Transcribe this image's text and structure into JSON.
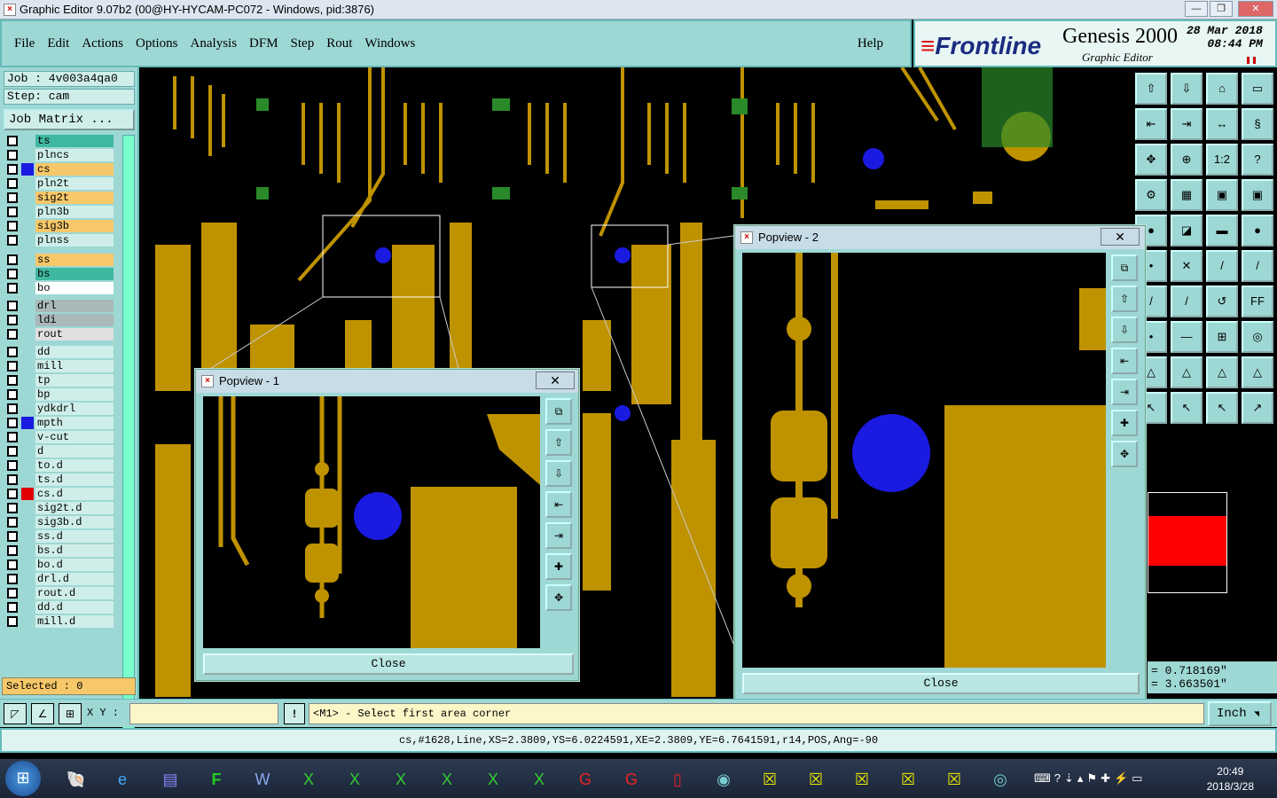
{
  "window": {
    "title": "Graphic Editor 9.07b2 (00@HY-HYCAM-PC072 - Windows, pid:3876)",
    "min": "—",
    "max": "❐",
    "close": "✕"
  },
  "menu": [
    "File",
    "Edit",
    "Actions",
    "Options",
    "Analysis",
    "DFM",
    "Step",
    "Rout",
    "Windows"
  ],
  "help": "Help",
  "brand": {
    "logo_prefix": "≡",
    "logo": "Frontline",
    "product": "Genesis 2000",
    "subtitle": "Graphic Editor",
    "date": "28 Mar 2018",
    "time": "08:44 PM"
  },
  "job": "Job : 4v003a4qa0",
  "step": "Step: cam",
  "job_matrix": "Job Matrix ...",
  "layers": [
    {
      "name": "ts",
      "bg": "#3fb8a0",
      "color": ""
    },
    {
      "name": "plncs",
      "bg": "#cfeee9",
      "color": ""
    },
    {
      "name": "cs",
      "bg": "#f7c86a",
      "color": "#1a1ae0"
    },
    {
      "name": "pln2t",
      "bg": "#cfeee9",
      "color": ""
    },
    {
      "name": "sig2t",
      "bg": "#f7c86a",
      "color": ""
    },
    {
      "name": "pln3b",
      "bg": "#cfeee9",
      "color": ""
    },
    {
      "name": "sig3b",
      "bg": "#f7c86a",
      "color": ""
    },
    {
      "name": "plnss",
      "bg": "#cfeee9",
      "color": ""
    },
    {
      "name": "ss",
      "bg": "#f7c86a",
      "color": ""
    },
    {
      "name": "bs",
      "bg": "#3fb8a0",
      "color": ""
    },
    {
      "name": "bo",
      "bg": "#ffffff",
      "color": ""
    },
    {
      "name": "drl",
      "bg": "#a9b8b8",
      "color": ""
    },
    {
      "name": "ldi",
      "bg": "#a9b8b8",
      "color": ""
    },
    {
      "name": "rout",
      "bg": "#e0e0e0",
      "color": ""
    },
    {
      "name": "dd",
      "bg": "#cfeee9",
      "color": ""
    },
    {
      "name": "mill",
      "bg": "#cfeee9",
      "color": ""
    },
    {
      "name": "tp",
      "bg": "#cfeee9",
      "color": ""
    },
    {
      "name": "bp",
      "bg": "#cfeee9",
      "color": ""
    },
    {
      "name": "ydkdrl",
      "bg": "#cfeee9",
      "color": ""
    },
    {
      "name": "mpth",
      "bg": "#cfeee9",
      "color": "#1a1ae0"
    },
    {
      "name": "v-cut",
      "bg": "#cfeee9",
      "color": ""
    },
    {
      "name": "d",
      "bg": "#cfeee9",
      "color": ""
    },
    {
      "name": "to.d",
      "bg": "#cfeee9",
      "color": ""
    },
    {
      "name": "ts.d",
      "bg": "#cfeee9",
      "color": ""
    },
    {
      "name": "cs.d",
      "bg": "#cfeee9",
      "color": "#e00000"
    },
    {
      "name": "sig2t.d",
      "bg": "#cfeee9",
      "color": ""
    },
    {
      "name": "sig3b.d",
      "bg": "#cfeee9",
      "color": ""
    },
    {
      "name": "ss.d",
      "bg": "#cfeee9",
      "color": ""
    },
    {
      "name": "bs.d",
      "bg": "#cfeee9",
      "color": ""
    },
    {
      "name": "bo.d",
      "bg": "#cfeee9",
      "color": ""
    },
    {
      "name": "drl.d",
      "bg": "#cfeee9",
      "color": ""
    },
    {
      "name": "rout.d",
      "bg": "#cfeee9",
      "color": ""
    },
    {
      "name": "dd.d",
      "bg": "#cfeee9",
      "color": ""
    },
    {
      "name": "mill.d",
      "bg": "#cfeee9",
      "color": ""
    }
  ],
  "selected": "Selected : 0",
  "coords": {
    "x": "= 0.718169\"",
    "y": "= 3.663501\""
  },
  "cmd": {
    "xy_label": "X Y :",
    "xy_value": "",
    "bang": "!",
    "prompt": "<M1> - Select first area corner",
    "units": "Inch"
  },
  "status": "cs,#1628,Line,XS=2.3809,YS=6.0224591,XE=2.3809,YE=6.7641591,r14,POS,Ang=-90",
  "popview1": {
    "title": "Popview - 1",
    "close": "Close"
  },
  "popview2": {
    "title": "Popview - 2",
    "close": "Close"
  },
  "tools": [
    "⇧",
    "⇩",
    "⌂",
    "▭",
    "⇤",
    "⇥",
    "↔",
    "§",
    "✥",
    "⊕",
    "1:2",
    "?",
    "⚙",
    "▦",
    "▣",
    "▣",
    "●",
    "◪",
    "▬",
    "●",
    "•",
    "✕",
    "/",
    "/",
    "/",
    "/",
    "↺",
    "FF",
    "•",
    "—",
    "⊞",
    "◎",
    "△",
    "△",
    "△",
    "△",
    "↖",
    "↖",
    "↖",
    "↗"
  ],
  "taskbar": {
    "time": "20:49",
    "date": "2018/3/28"
  }
}
